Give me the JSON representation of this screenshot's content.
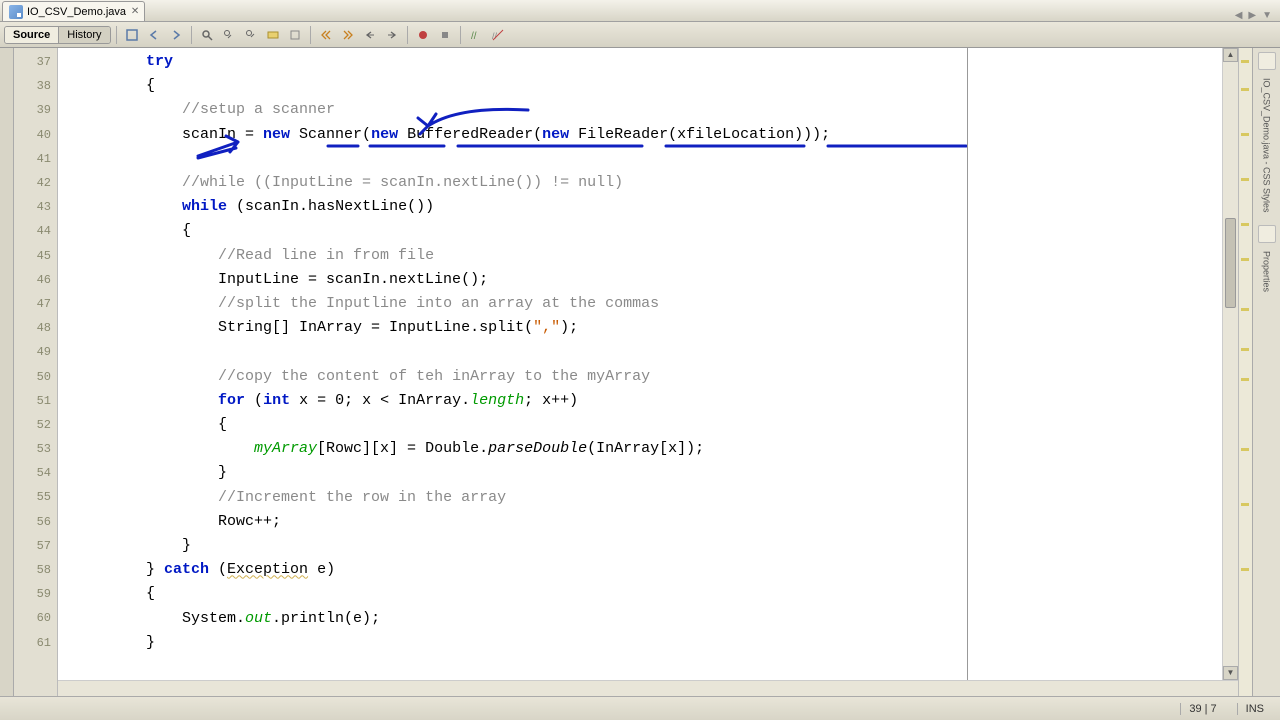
{
  "tab": {
    "filename": "IO_CSV_Demo.java"
  },
  "view_tabs": {
    "source": "Source",
    "history": "History"
  },
  "rail": {
    "styles_label": "IO_CSV_Demo.java - CSS Styles",
    "properties_label": "Properties"
  },
  "status": {
    "pos": "39 | 7",
    "mode": "INS"
  },
  "gutter_lines": [
    "37",
    "38",
    "39",
    "40",
    "41",
    "42",
    "43",
    "44",
    "45",
    "46",
    "47",
    "48",
    "49",
    "50",
    "51",
    "52",
    "53",
    "54",
    "55",
    "56",
    "57",
    "58",
    "59",
    "60",
    "61"
  ],
  "code": {
    "l0": "        try",
    "l1": "        {",
    "l2a": "            ",
    "l2c": "//setup a scanner",
    "l3a": "            scanIn = ",
    "l3k1": "new",
    "l3b": " Scanner(",
    "l3k2": "new",
    "l3c": " BufferedReader(",
    "l3k3": "new",
    "l3d": " FileReader(xfileLocation)));",
    "l4": "",
    "l5a": "            ",
    "l5c": "//while ((InputLine = scanIn.nextLine()) != null)",
    "l6a": "            ",
    "l6k": "while",
    "l6b": " (scanIn.hasNextLine())",
    "l7": "            {",
    "l8a": "                ",
    "l8c": "//Read line in from file",
    "l9": "                InputLine = scanIn.nextLine();",
    "l10a": "                ",
    "l10c": "//split the Inputline into an array at the commas",
    "l11a": "                String[] InArray = InputLine.split(",
    "l11s": "\",\"",
    "l11b": ");",
    "l12": "",
    "l13a": "                ",
    "l13c": "//copy the content of teh inArray to the myArray",
    "l14a": "                ",
    "l14k1": "for",
    "l14b": " (",
    "l14k2": "int",
    "l14c": " x = 0; x < InArray.",
    "l14f": "length",
    "l14d": "; x++)",
    "l15": "                {",
    "l16a": "                    ",
    "l16f": "myArray",
    "l16b": "[Rowc][x] = Double.",
    "l16m": "parseDouble",
    "l16c": "(InArray[x]);",
    "l17": "                }",
    "l18a": "                ",
    "l18c": "//Increment the row in the array",
    "l19": "                Rowc++;",
    "l20": "            }",
    "l21a": "        } ",
    "l21k": "catch",
    "l21b": " (",
    "l21u": "Exception",
    "l21c": " e)",
    "l22": "        {",
    "l23a": "            System.",
    "l23f": "out",
    "l23b": ".println(e);",
    "l24": "        }"
  },
  "icons": {
    "annotation_pen": "pen-icon"
  }
}
